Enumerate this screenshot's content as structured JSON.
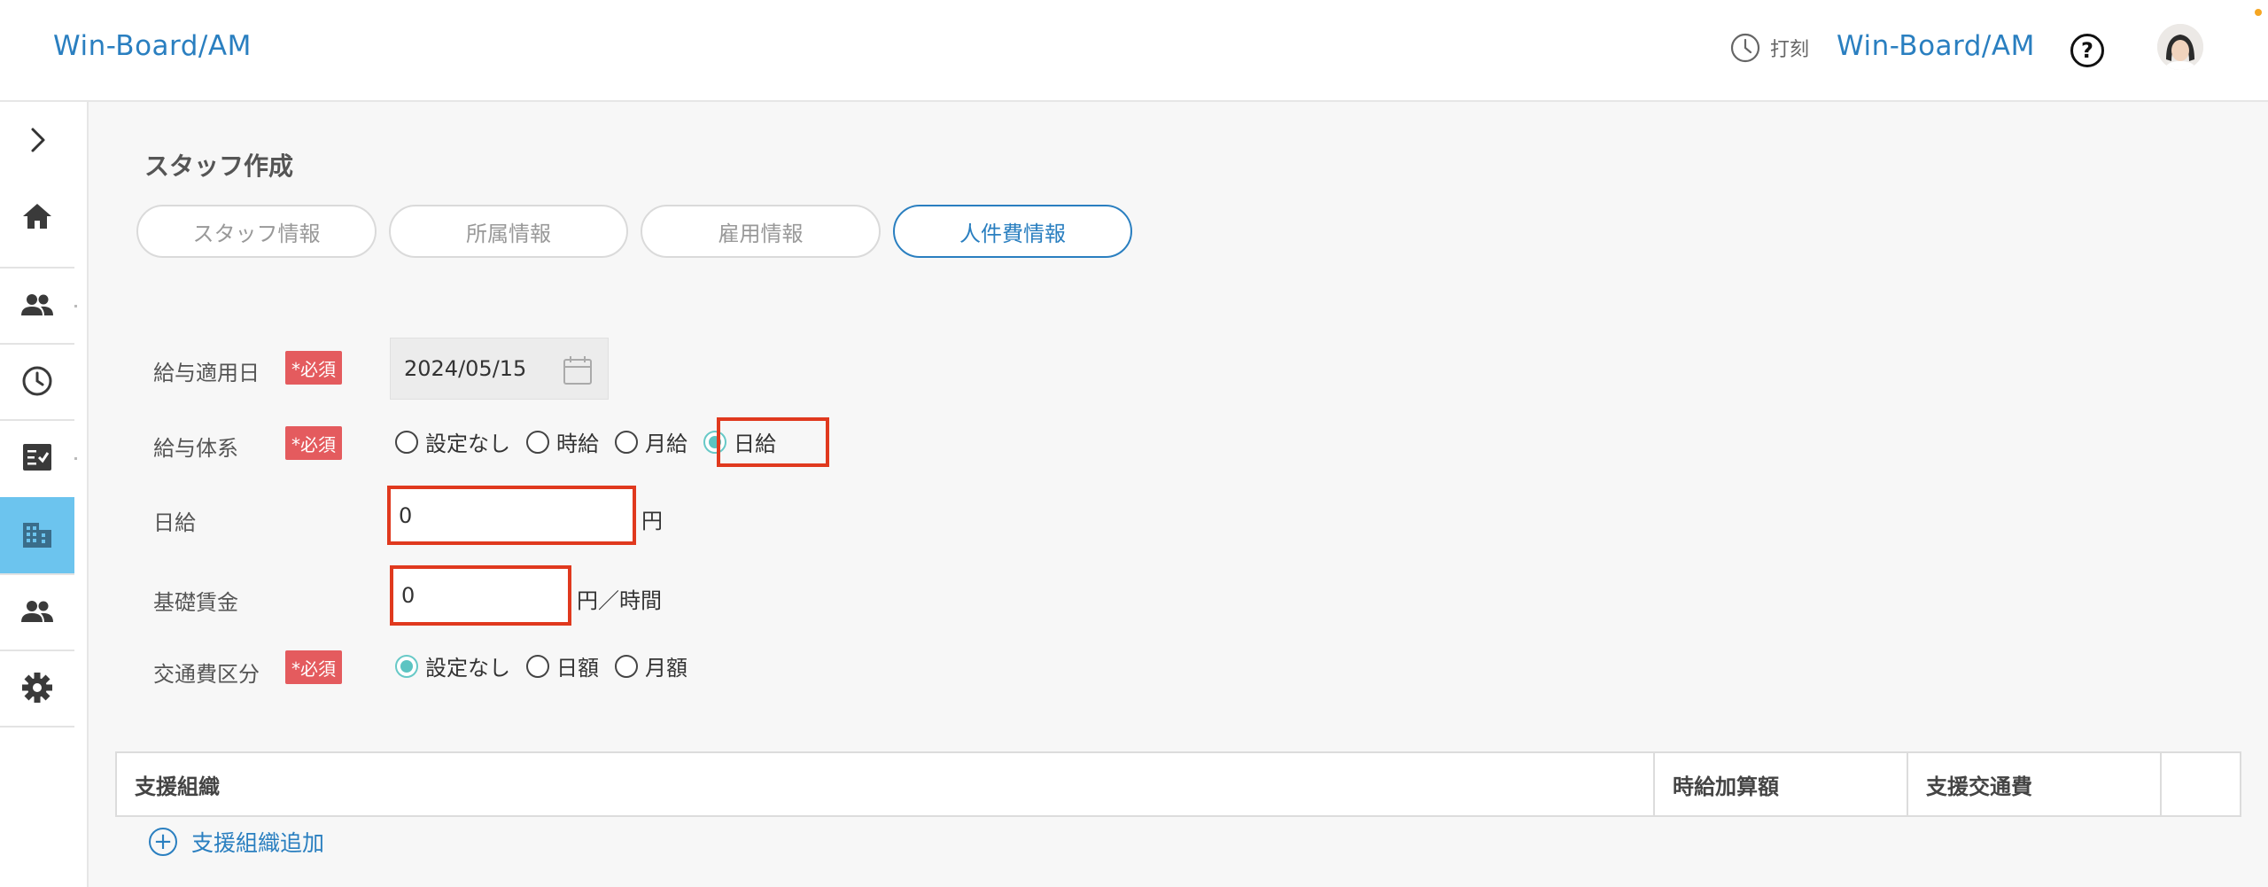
{
  "header": {
    "brand": "Win-Board/AM",
    "punch_label": "打刻",
    "brand_right": "Win-Board/AM",
    "help_symbol": "?"
  },
  "sidebar": {
    "items": [
      {
        "icon": "chevron-right-icon"
      },
      {
        "icon": "home-icon"
      },
      {
        "icon": "people-icon"
      },
      {
        "icon": "clock-icon"
      },
      {
        "icon": "checklist-icon"
      },
      {
        "icon": "building-icon",
        "active": true
      },
      {
        "icon": "people-icon"
      },
      {
        "icon": "gear-icon"
      }
    ],
    "active_color": "#6cc4ee"
  },
  "page": {
    "title": "スタッフ作成",
    "tabs": [
      {
        "label": "スタッフ情報",
        "active": false
      },
      {
        "label": "所属情報",
        "active": false
      },
      {
        "label": "雇用情報",
        "active": false
      },
      {
        "label": "人件費情報",
        "active": true
      }
    ]
  },
  "form": {
    "required_badge": "*必須",
    "salary_date": {
      "label": "給与適用日",
      "value": "2024/05/15"
    },
    "salary_system": {
      "label": "給与体系",
      "options": [
        "設定なし",
        "時給",
        "月給",
        "日給"
      ],
      "selected": "日給"
    },
    "daily_wage": {
      "label": "日給",
      "value": "0",
      "unit": "円"
    },
    "base_wage": {
      "label": "基礎賃金",
      "value": "0",
      "unit": "円／時間"
    },
    "transport": {
      "label": "交通費区分",
      "options": [
        "設定なし",
        "日額",
        "月額"
      ],
      "selected": "設定なし"
    }
  },
  "support_table": {
    "columns": [
      "支援組織",
      "時給加算額",
      "支援交通費",
      ""
    ],
    "add_label": "支援組織追加"
  },
  "colors": {
    "brand": "#2a7fc0",
    "required": "#e45b5e",
    "highlight": "#e0391e",
    "radio_on": "#5cc4c2"
  }
}
